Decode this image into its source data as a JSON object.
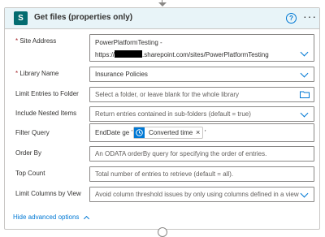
{
  "header": {
    "title": "Get files (properties only)",
    "help_label": "?",
    "more_label": "···",
    "logo_letter": "S"
  },
  "fields": {
    "site_address": {
      "label": "Site Address",
      "required": true,
      "line1": "PowerPlatformTesting -",
      "line2_prefix": "https://",
      "line2_suffix": ".sharepoint.com/sites/PowerPlatformTesting"
    },
    "library_name": {
      "label": "Library Name",
      "required": true,
      "value": "Insurance Policies"
    },
    "limit_folder": {
      "label": "Limit Entries to Folder",
      "placeholder": "Select a folder, or leave blank for the whole library"
    },
    "nested_items": {
      "label": "Include Nested Items",
      "placeholder": "Return entries contained in sub-folders (default = true)"
    },
    "filter_query": {
      "label": "Filter Query",
      "prefix": "EndDate ge '",
      "token": "Converted time",
      "token_close": "×",
      "suffix": "'"
    },
    "order_by": {
      "label": "Order By",
      "placeholder": "An ODATA orderBy query for specifying the order of entries."
    },
    "top_count": {
      "label": "Top Count",
      "placeholder": "Total number of entries to retrieve (default = all)."
    },
    "limit_columns": {
      "label": "Limit Columns by View",
      "placeholder": "Avoid column threshold issues by only using columns defined in a view"
    }
  },
  "footer": {
    "hide_advanced": "Hide advanced options"
  },
  "colors": {
    "accent": "#0078d4",
    "header_bg": "#e8f4f8",
    "sharepoint": "#036c70",
    "required": "#a4262c"
  },
  "icons": [
    "sharepoint-icon",
    "help-icon",
    "more-icon",
    "chevron-down-icon",
    "folder-icon",
    "clock-icon",
    "chevron-up-icon"
  ]
}
